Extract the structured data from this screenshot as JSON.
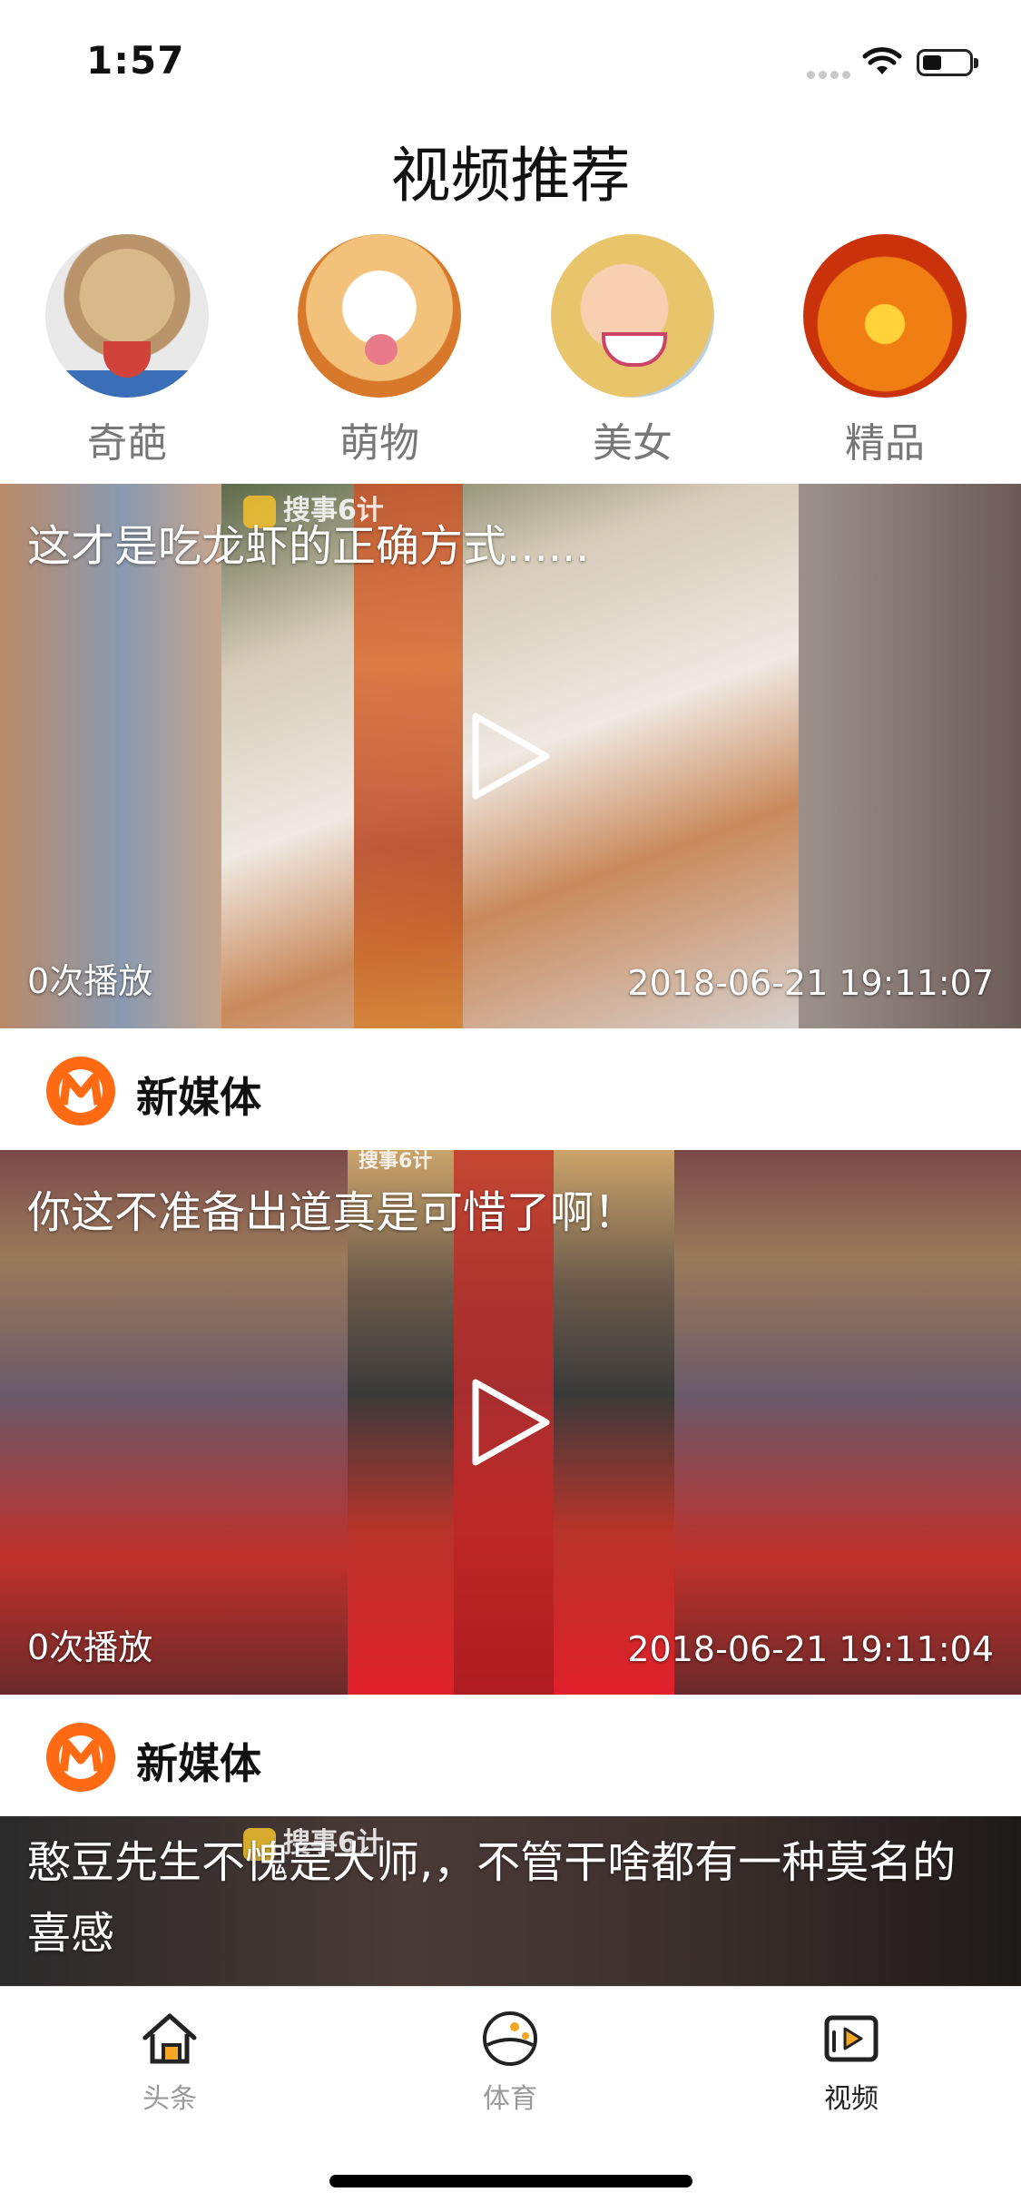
{
  "status_bar": {
    "time": "1:57"
  },
  "header": {
    "title": "视频推荐"
  },
  "categories": [
    {
      "label": "奇葩",
      "icon": "weird-category-image"
    },
    {
      "label": "萌物",
      "icon": "cute-animal-category-image"
    },
    {
      "label": "美女",
      "icon": "beauty-category-image"
    },
    {
      "label": "精品",
      "icon": "featured-category-image"
    }
  ],
  "videos": [
    {
      "title": "这才是吃龙虾的正确方式......",
      "plays": "0次播放",
      "time": "2018-06-21 19:11:07",
      "source": "新媒体",
      "watermark": "搜事6计"
    },
    {
      "title": "你这不准备出道真是可惜了啊！",
      "plays": "0次播放",
      "time": "2018-06-21 19:11:04",
      "source": "新媒体",
      "watermark": "搜事6计"
    },
    {
      "title": "憨豆先生不愧是大师,，不管干啥都有一种莫名的喜感",
      "watermark": "搜事6计"
    }
  ],
  "tabbar": {
    "items": [
      {
        "label": "头条",
        "icon": "home-icon"
      },
      {
        "label": "体育",
        "icon": "sports-ball-icon"
      },
      {
        "label": "视频",
        "icon": "video-play-icon"
      }
    ],
    "active_color": "#f5a623"
  }
}
